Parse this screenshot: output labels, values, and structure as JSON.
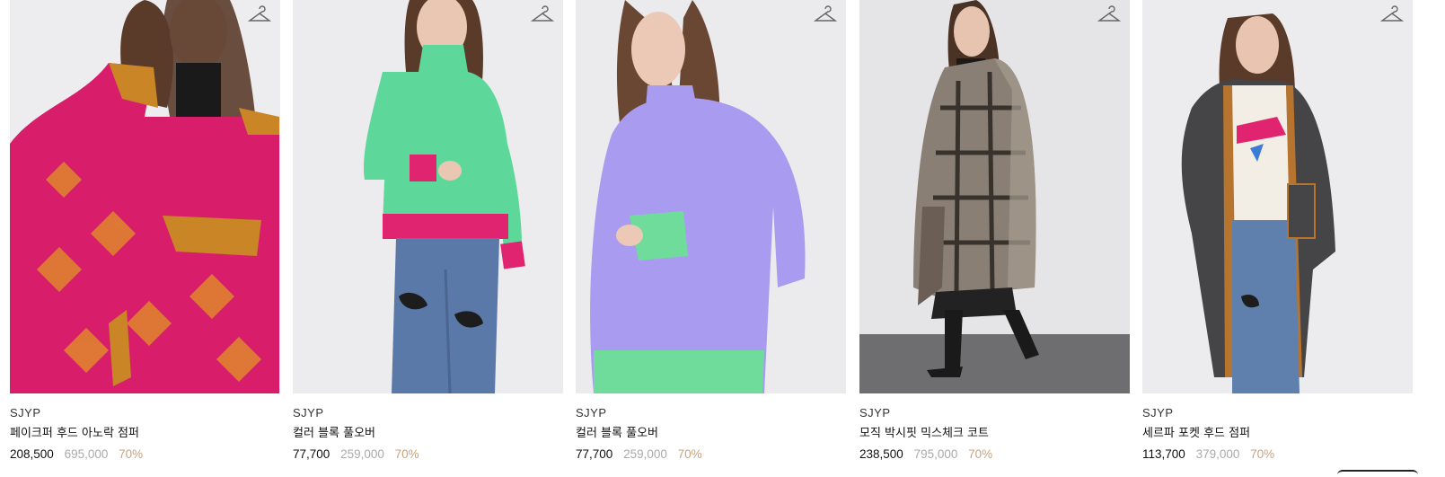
{
  "products": [
    {
      "brand": "SJYP",
      "name": "페이크퍼 후드 아노락 점퍼",
      "price": "208,500",
      "original_price": "695,000",
      "discount": "70%",
      "image_desc_icon": "hanger-icon",
      "colors": {
        "bg": "#ededef",
        "main": "#d81e6a",
        "accent": "#c98526",
        "hair": "#5a3b2a",
        "skin": "#e8c3ad"
      }
    },
    {
      "brand": "SJYP",
      "name": "컬러 블록 풀오버",
      "price": "77,700",
      "original_price": "259,000",
      "discount": "70%",
      "image_desc_icon": "hanger-icon",
      "colors": {
        "bg": "#ececee",
        "main": "#5ed89a",
        "accent": "#e0246f",
        "hair": "#5a3b2a",
        "skin": "#e9c7b3",
        "pants": "#5a79a8"
      }
    },
    {
      "brand": "SJYP",
      "name": "컬러 블록 풀오버",
      "price": "77,700",
      "original_price": "259,000",
      "discount": "70%",
      "image_desc_icon": "hanger-icon",
      "colors": {
        "bg": "#ebebed",
        "main": "#a99cf0",
        "accent": "#6fdc9c",
        "hair": "#6a4733",
        "skin": "#ecc9b6"
      }
    },
    {
      "brand": "SJYP",
      "name": "모직 박시핏 믹스체크 코트",
      "price": "238,500",
      "original_price": "795,000",
      "discount": "70%",
      "image_desc_icon": "hanger-icon",
      "colors": {
        "bg": "#e5e5e7",
        "main": "#8a7f74",
        "accent": "#d9d2c5",
        "hair": "#4a3325",
        "skin": "#e6c4b0",
        "floor": "#6e6e70",
        "boots": "#1a1a1a"
      }
    },
    {
      "brand": "SJYP",
      "name": "세르파 포켓 후드 점퍼",
      "price": "113,700",
      "original_price": "379,000",
      "discount": "70%",
      "image_desc_icon": "hanger-icon",
      "colors": {
        "bg": "#ececee",
        "main": "#454548",
        "accent": "#b7742f",
        "hair": "#5a3b2a",
        "skin": "#e9c5b1",
        "pants": "#5f7fad",
        "top": "#f2eee6"
      }
    }
  ]
}
